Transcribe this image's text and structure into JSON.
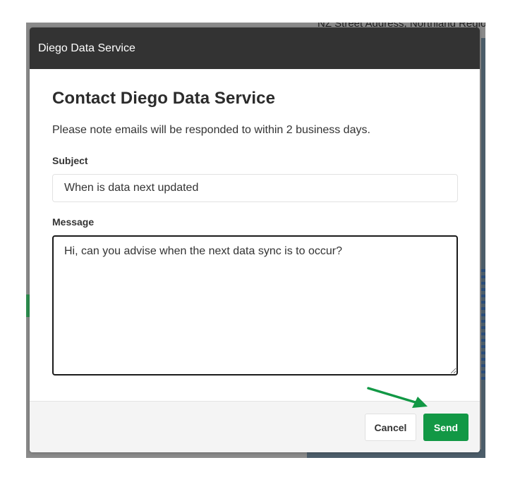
{
  "background": {
    "address_text": "NZ Street Address, Northland Regio"
  },
  "modal": {
    "header_title": "Diego Data Service",
    "title": "Contact Diego Data Service",
    "note": "Please note emails will be responded to within 2 business days.",
    "subject": {
      "label": "Subject",
      "value": "When is data next updated"
    },
    "message": {
      "label": "Message",
      "value": "Hi, can you advise when the next data sync is to occur?"
    },
    "footer": {
      "cancel_label": "Cancel",
      "send_label": "Send"
    }
  },
  "colors": {
    "header_bg": "#333333",
    "send_bg": "#129845",
    "annotation_arrow": "#129845"
  },
  "icons": {
    "annotation": "arrow-pointing-send"
  }
}
